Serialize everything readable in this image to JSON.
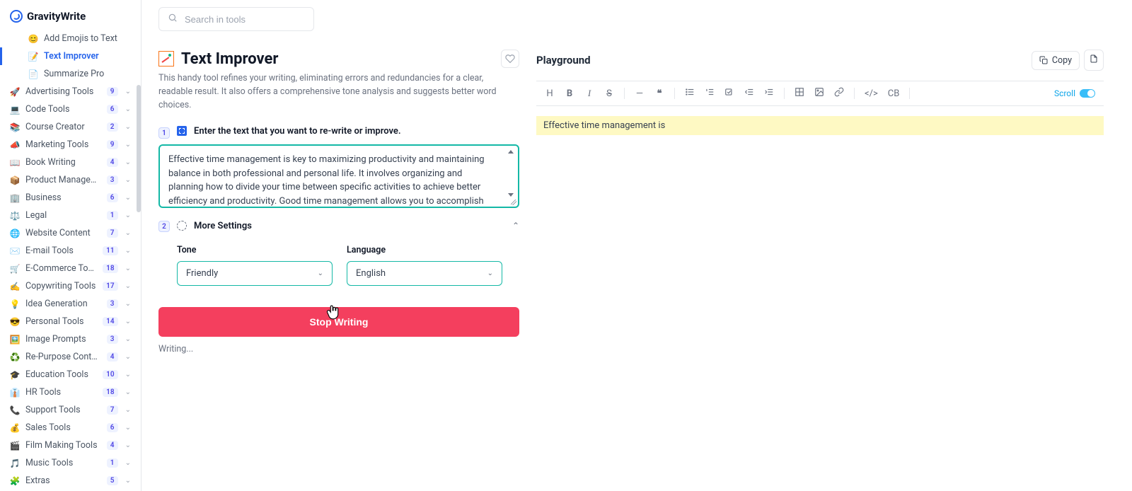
{
  "brand": "GravityWrite",
  "search_placeholder": "Search in tools",
  "sidebar": {
    "sub": [
      {
        "icon": "😊",
        "label": "Add Emojis to Text"
      },
      {
        "icon": "📝",
        "label": "Text Improver",
        "active": true
      },
      {
        "icon": "📄",
        "label": "Summarize Pro"
      }
    ],
    "cats": [
      {
        "icon": "🚀",
        "label": "Advertising Tools",
        "badge": "9"
      },
      {
        "icon": "💻",
        "label": "Code Tools",
        "badge": "6"
      },
      {
        "icon": "📚",
        "label": "Course Creator",
        "badge": "2"
      },
      {
        "icon": "📣",
        "label": "Marketing Tools",
        "badge": "9"
      },
      {
        "icon": "📖",
        "label": "Book Writing",
        "badge": "4"
      },
      {
        "icon": "📦",
        "label": "Product Management",
        "badge": "3"
      },
      {
        "icon": "🏢",
        "label": "Business",
        "badge": "6"
      },
      {
        "icon": "⚖️",
        "label": "Legal",
        "badge": "1"
      },
      {
        "icon": "🌐",
        "label": "Website Content",
        "badge": "7"
      },
      {
        "icon": "✉️",
        "label": "E-mail Tools",
        "badge": "11"
      },
      {
        "icon": "🛒",
        "label": "E-Commerce Tools",
        "badge": "18"
      },
      {
        "icon": "✍️",
        "label": "Copywriting Tools",
        "badge": "17"
      },
      {
        "icon": "💡",
        "label": "Idea Generation",
        "badge": "3"
      },
      {
        "icon": "😎",
        "label": "Personal Tools",
        "badge": "14"
      },
      {
        "icon": "🖼️",
        "label": "Image Prompts",
        "badge": "3"
      },
      {
        "icon": "♻️",
        "label": "Re-Purpose Content",
        "badge": "4"
      },
      {
        "icon": "🎓",
        "label": "Education Tools",
        "badge": "10"
      },
      {
        "icon": "👔",
        "label": "HR Tools",
        "badge": "18"
      },
      {
        "icon": "📞",
        "label": "Support Tools",
        "badge": "7"
      },
      {
        "icon": "💰",
        "label": "Sales Tools",
        "badge": "6"
      },
      {
        "icon": "🎬",
        "label": "Film Making Tools",
        "badge": "4"
      },
      {
        "icon": "🎵",
        "label": "Music Tools",
        "badge": "1"
      },
      {
        "icon": "🧩",
        "label": "Extras",
        "badge": "5"
      }
    ]
  },
  "tool": {
    "title": "Text Improver",
    "desc": "This handy tool refines your writing, eliminating errors and redundancies for a clear, readable result. It also offers a comprehensive tone analysis and suggests better word choices.",
    "step1_label": "Enter the text that you want to re-write or improve.",
    "step1_value": "Effective time management is key to maximizing productivity and maintaining balance in both professional and personal life. It involves organizing and planning how to divide your time between specific activities to achieve better efficiency and productivity. Good time management allows you to accomplish",
    "step2_label": "More Settings",
    "tone_label": "Tone",
    "tone_value": "Friendly",
    "lang_label": "Language",
    "lang_value": "English",
    "button_label": "Stop Writing",
    "status": "Writing..."
  },
  "playground": {
    "title": "Playground",
    "copy_label": "Copy",
    "scroll_label": "Scroll",
    "output_text": "Effective time management is",
    "toolbar": {
      "h": "H",
      "cb": "CB"
    }
  }
}
